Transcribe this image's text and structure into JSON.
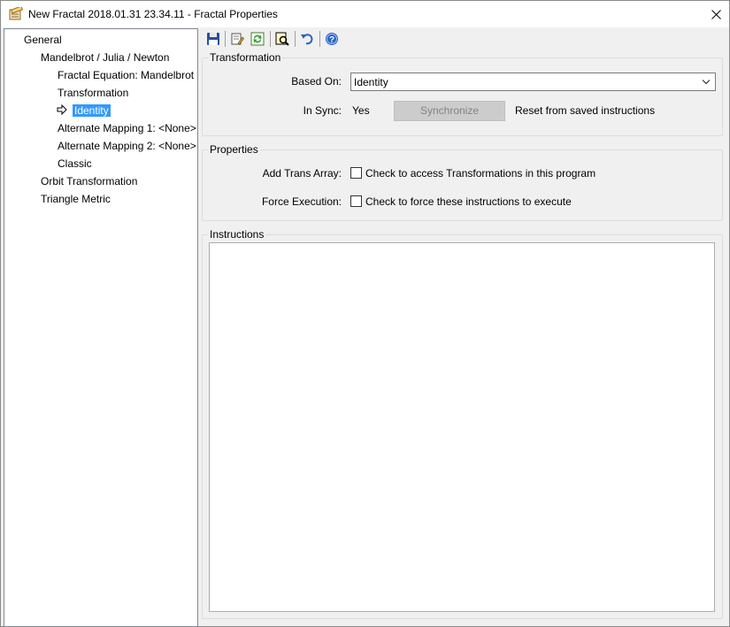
{
  "window": {
    "title": "New Fractal 2018.01.31 23.34.11 - Fractal Properties"
  },
  "tree": {
    "items": [
      {
        "label": "General",
        "level": 0
      },
      {
        "label": "Mandelbrot / Julia / Newton",
        "level": 1
      },
      {
        "label": "Fractal Equation: Mandelbrot",
        "level": 2
      },
      {
        "label": "Transformation",
        "level": 2
      },
      {
        "label": "Identity",
        "level": 2,
        "selected": true
      },
      {
        "label": "Alternate Mapping 1: <None>",
        "level": 2
      },
      {
        "label": "Alternate Mapping 2: <None>",
        "level": 2
      },
      {
        "label": "Classic",
        "level": 2
      },
      {
        "label": "Orbit Transformation",
        "level": 1
      },
      {
        "label": "Triangle Metric",
        "level": 1
      }
    ]
  },
  "toolbar": {
    "icons": [
      "save-icon",
      "edit-icon",
      "refresh-icon",
      "preview-icon",
      "undo-icon",
      "help-icon"
    ]
  },
  "transformation": {
    "group_title": "Transformation",
    "based_on_label": "Based On:",
    "based_on_value": "Identity",
    "in_sync_label": "In Sync:",
    "in_sync_value": "Yes",
    "synchronize_label": "Synchronize",
    "reset_text": "Reset from saved instructions"
  },
  "properties": {
    "group_title": "Properties",
    "add_trans_label": "Add Trans Array:",
    "add_trans_text": "Check to access Transformations in this program",
    "add_trans_checked": false,
    "force_exec_label": "Force Execution:",
    "force_exec_text": "Check to force these instructions to execute",
    "force_exec_checked": false
  },
  "instructions": {
    "group_title": "Instructions",
    "content": ""
  },
  "colors": {
    "selection": "#3399ff",
    "window_bg": "#f0f0f0",
    "disabled_button": "#cccccc"
  }
}
